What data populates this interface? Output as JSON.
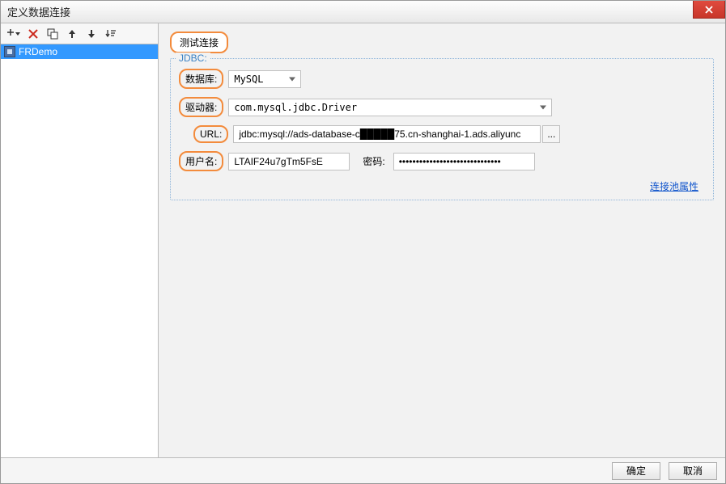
{
  "window": {
    "title": "定义数据连接"
  },
  "sidebar": {
    "items": [
      {
        "name": "FRDemo"
      }
    ]
  },
  "main": {
    "test_label": "测试连接",
    "jdbc_section": "JDBC:",
    "db_label": "数据库:",
    "db_value": "MySQL",
    "driver_label": "驱动器:",
    "driver_value": "com.mysql.jdbc.Driver",
    "url_label": "URL:",
    "url_value": "jdbc:mysql://ads-database-c█████75.cn-shanghai-1.ads.aliyunc",
    "user_label": "用户名:",
    "user_value": "LTAIF24u7gTm5FsE",
    "pass_label": "密码:",
    "pass_value": "••••••••••••••••••••••••••••••",
    "pool_link": "连接池属性"
  },
  "footer": {
    "ok": "确定",
    "cancel": "取消"
  }
}
